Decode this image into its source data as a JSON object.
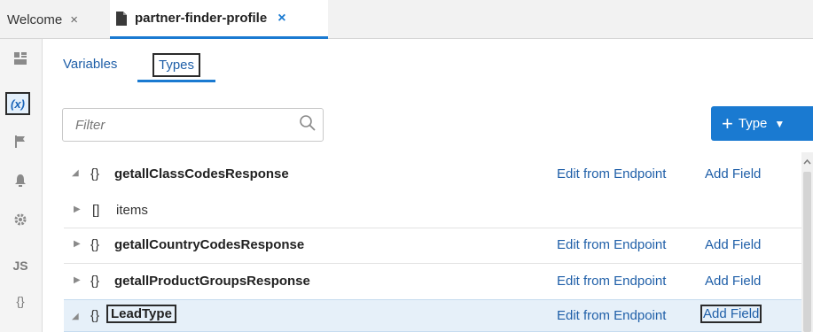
{
  "tabs": {
    "welcome_label": "Welcome",
    "welcome_close": "×",
    "active_label": "partner-finder-profile",
    "active_close": "×"
  },
  "rail": {
    "active_icon_label": "(x)",
    "js_label": "JS",
    "braces_label": "{}"
  },
  "subtabs": {
    "variables": "Variables",
    "types": "Types"
  },
  "filter": {
    "placeholder": "Filter",
    "value": ""
  },
  "type_button": {
    "plus": "+",
    "label": "Type",
    "caret": "▼"
  },
  "rows": [
    {
      "toggle": "◢",
      "braces": "{}",
      "name": "getallClassCodesResponse",
      "edit": "Edit from Endpoint",
      "add": "Add Field"
    },
    {
      "toggle": "▶",
      "braces": "[]",
      "name": "items"
    },
    {
      "toggle": "▶",
      "braces": "{}",
      "name": "getallCountryCodesResponse",
      "edit": "Edit from Endpoint",
      "add": "Add Field"
    },
    {
      "toggle": "▶",
      "braces": "{}",
      "name": "getallProductGroupsResponse",
      "edit": "Edit from Endpoint",
      "add": "Add Field"
    },
    {
      "toggle": "◢",
      "braces": "{}",
      "name": "LeadType",
      "edit": "Edit from Endpoint",
      "add": "Add Field"
    }
  ],
  "colors": {
    "accent": "#1a7ad1",
    "link": "#1f5fa8",
    "selected_row": "#e6f0f9"
  },
  "icons": [
    "file-icon",
    "close-icon",
    "palette-icon",
    "variables-icon",
    "flag-icon",
    "bell-icon",
    "gear-icon",
    "search-icon",
    "expand-triangle-icon",
    "collapse-triangle-icon"
  ]
}
